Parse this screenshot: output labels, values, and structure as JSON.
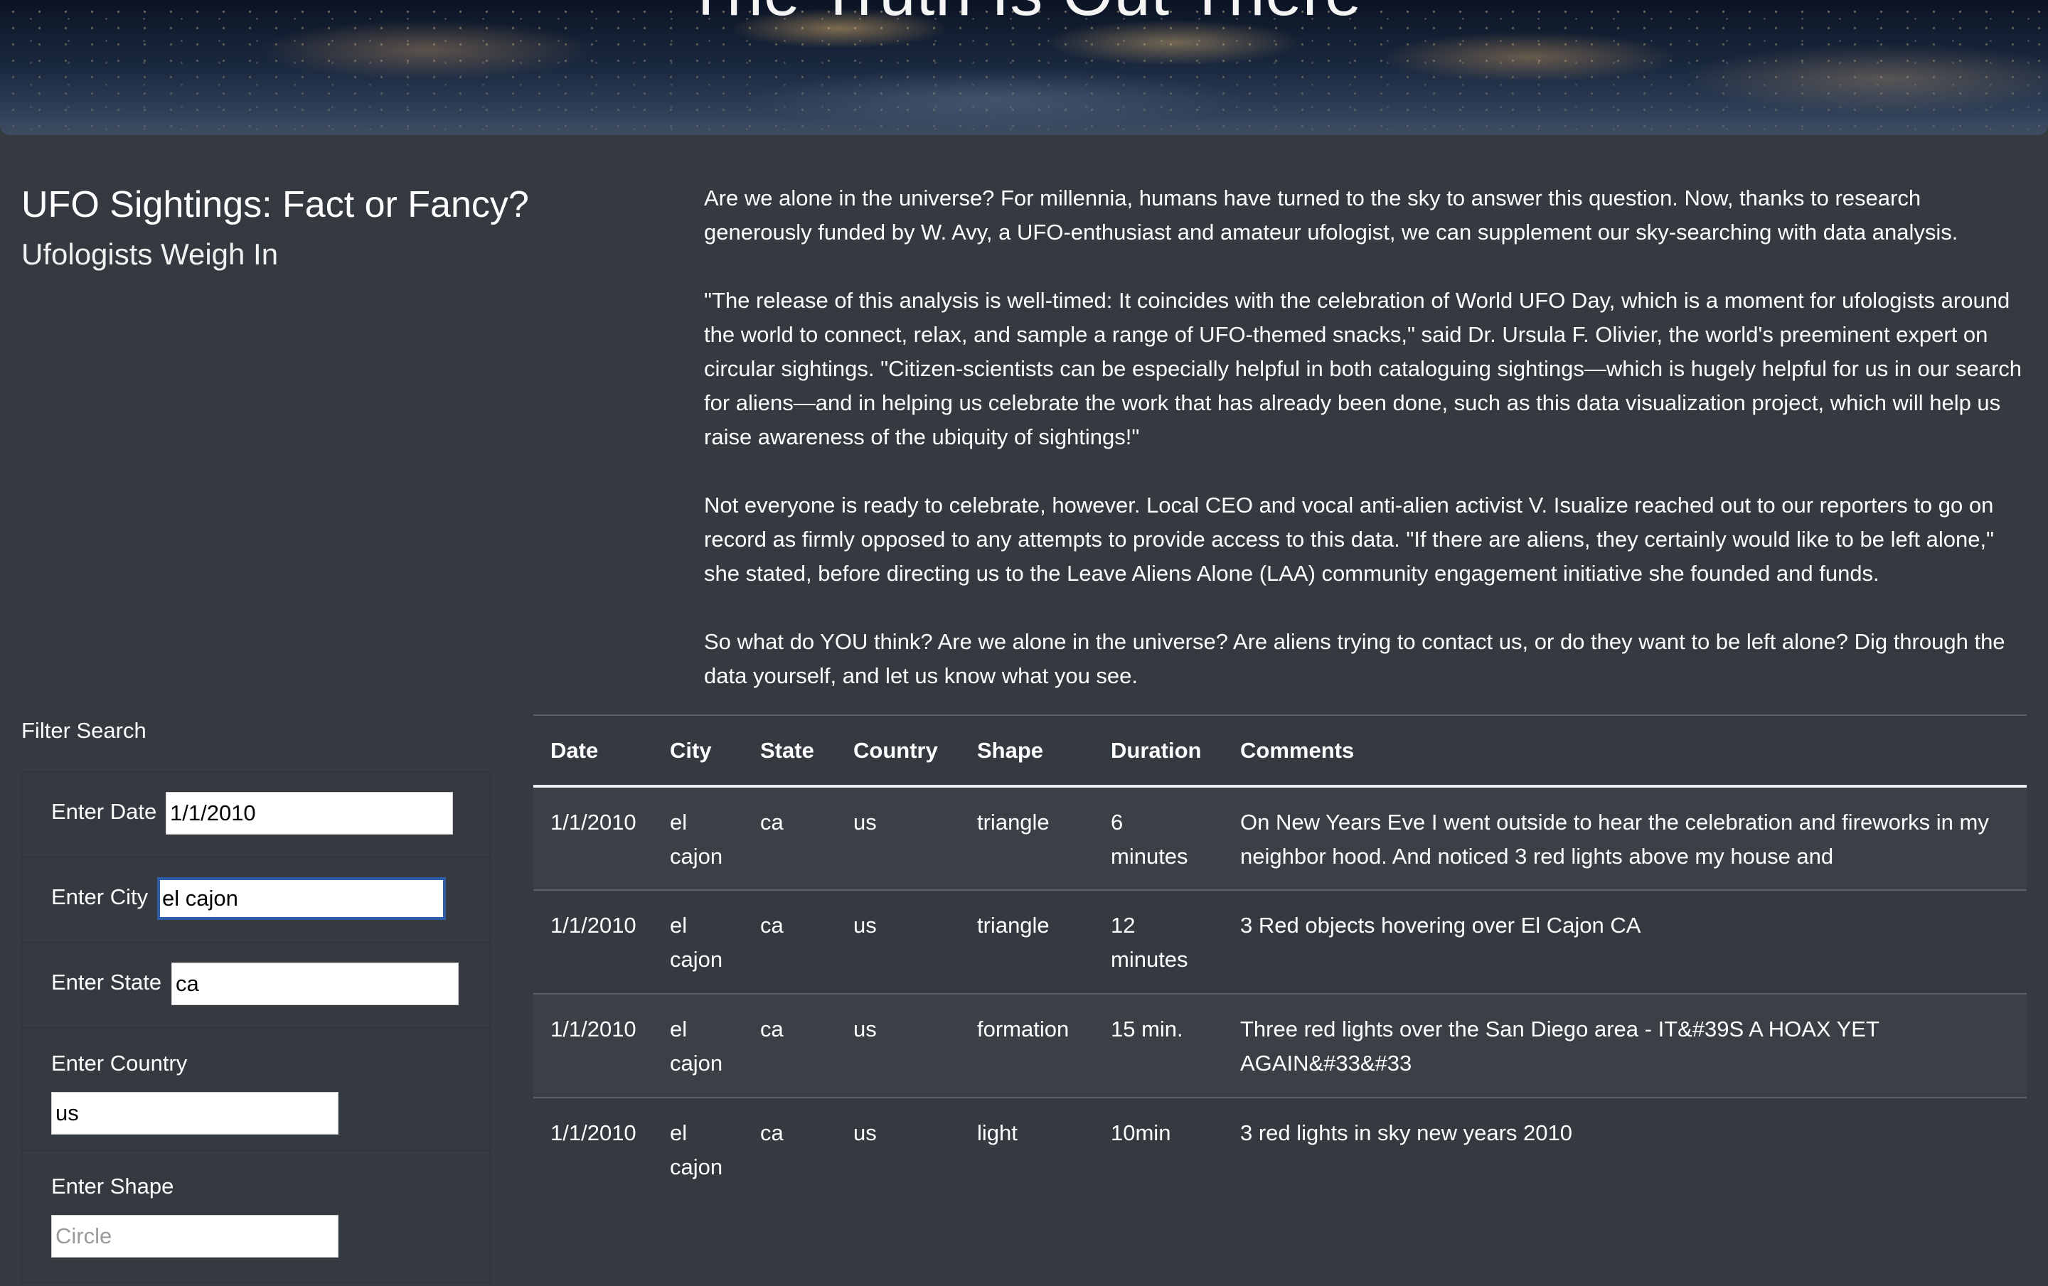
{
  "hero": {
    "title": "The Truth Is Out There"
  },
  "header": {
    "heading": "UFO Sightings: Fact or Fancy?",
    "subheading": "Ufologists Weigh In"
  },
  "article": {
    "paragraphs": [
      "Are we alone in the universe? For millennia, humans have turned to the sky to answer this question. Now, thanks to research generously funded by W. Avy, a UFO-enthusiast and amateur ufologist, we can supplement our sky-searching with data analysis.",
      "\"The release of this analysis is well-timed: It coincides with the celebration of World UFO Day, which is a moment for ufologists around the world to connect, relax, and sample a range of UFO-themed snacks,\" said Dr. Ursula F. Olivier, the world's preeminent expert on circular sightings. \"Citizen-scientists can be especially helpful in both cataloguing sightings—which is hugely helpful for us in our search for aliens—and in helping us celebrate the work that has already been done, such as this data visualization project, which will help us raise awareness of the ubiquity of sightings!\"",
      "Not everyone is ready to celebrate, however. Local CEO and vocal anti-alien activist V. Isualize reached out to our reporters to go on record as firmly opposed to any attempts to provide access to this data. \"If there are aliens, they certainly would like to be left alone,\" she stated, before directing us to the Leave Aliens Alone (LAA) community engagement initiative she founded and funds.",
      "So what do YOU think? Are we alone in the universe? Are aliens trying to contact us, or do they want to be left alone? Dig through the data yourself, and let us know what you see."
    ]
  },
  "filters": {
    "title": "Filter Search",
    "date": {
      "label": "Enter Date",
      "value": "1/1/2010",
      "placeholder": ""
    },
    "city": {
      "label": "Enter City",
      "value": "el cajon",
      "placeholder": ""
    },
    "state": {
      "label": "Enter State",
      "value": "ca",
      "placeholder": ""
    },
    "country": {
      "label": "Enter Country",
      "value": "us",
      "placeholder": ""
    },
    "shape": {
      "label": "Enter Shape",
      "value": "",
      "placeholder": "Circle"
    }
  },
  "table": {
    "columns": [
      "Date",
      "City",
      "State",
      "Country",
      "Shape",
      "Duration",
      "Comments"
    ],
    "rows": [
      [
        "1/1/2010",
        "el cajon",
        "ca",
        "us",
        "triangle",
        "6 minutes",
        "On New Years Eve I went outside to hear the celebration and fireworks in my neighbor hood. And noticed 3 red lights above my house and"
      ],
      [
        "1/1/2010",
        "el cajon",
        "ca",
        "us",
        "triangle",
        "12 minutes",
        "3 Red objects hovering over El Cajon CA"
      ],
      [
        "1/1/2010",
        "el cajon",
        "ca",
        "us",
        "formation",
        "15 min.",
        "Three red lights over the San Diego area - IT&#39S A HOAX YET AGAIN&#33&#33"
      ],
      [
        "1/1/2010",
        "el cajon",
        "ca",
        "us",
        "light",
        "10min",
        "3 red lights in sky new years 2010"
      ]
    ]
  }
}
